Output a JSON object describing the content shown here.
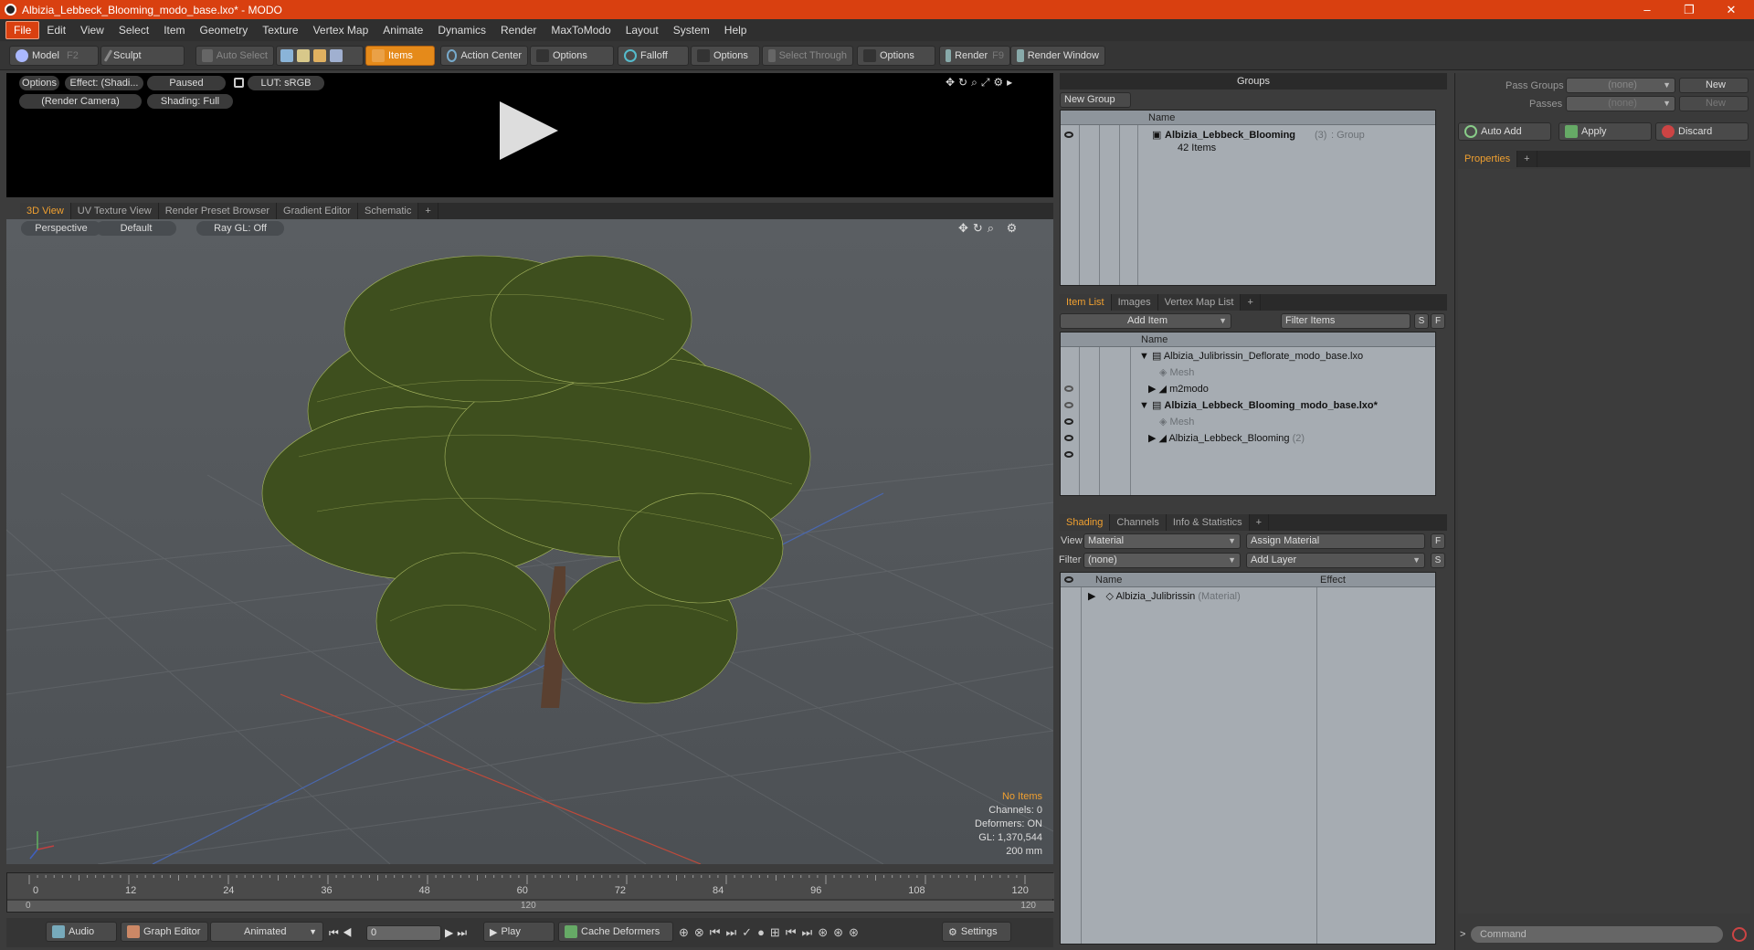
{
  "window": {
    "title": "Albizia_Lebbeck_Blooming_modo_base.lxo* - MODO",
    "minimize": "–",
    "restore": "❐",
    "close": "✕"
  },
  "menu": [
    "File",
    "Edit",
    "View",
    "Select",
    "Item",
    "Geometry",
    "Texture",
    "Vertex Map",
    "Animate",
    "Dynamics",
    "Render",
    "MaxToModo",
    "Layout",
    "System",
    "Help"
  ],
  "toolbar": {
    "model": "Model",
    "model_key": "F2",
    "sculpt": "Sculpt",
    "auto_select": "Auto Select",
    "items": "Items",
    "action_center": "Action Center",
    "options1": "Options",
    "falloff": "Falloff",
    "options2": "Options",
    "select_through": "Select Through",
    "options3": "Options",
    "render": "Render",
    "render_key": "F9",
    "render_window": "Render Window"
  },
  "render_preview": {
    "options": "Options",
    "effect": "Effect: (Shadi...",
    "paused": "Paused",
    "lut": "LUT: sRGB",
    "camera": "(Render Camera)",
    "shading": "Shading: Full"
  },
  "view_tabs": [
    "3D View",
    "UV Texture View",
    "Render Preset Browser",
    "Gradient Editor",
    "Schematic",
    "+"
  ],
  "viewport": {
    "projection": "Perspective",
    "style": "Default",
    "raygl": "Ray GL: Off",
    "stats": {
      "items": "No Items",
      "channels": "Channels: 0",
      "deformers": "Deformers: ON",
      "gl": "GL: 1,370,544",
      "scale": "200 mm"
    }
  },
  "timeline": {
    "ticks": [
      "0",
      "12",
      "24",
      "36",
      "48",
      "60",
      "72",
      "84",
      "96",
      "108",
      "120"
    ],
    "sub_start": "0",
    "sub_mid": "120",
    "sub_end": "120"
  },
  "bottom": {
    "audio": "Audio",
    "graph_editor": "Graph Editor",
    "animated": "Animated",
    "frame": "0",
    "play": "Play",
    "cache": "Cache Deformers",
    "settings": "Settings"
  },
  "groups": {
    "title": "Groups",
    "new_group": "New Group",
    "col_name": "Name",
    "group_name": "Albizia_Lebbeck_Blooming",
    "group_count": "(3)",
    "group_type": ": Group",
    "items_count": "42 Items"
  },
  "item_list": {
    "tabs": [
      "Item List",
      "Images",
      "Vertex Map List",
      "+"
    ],
    "add_item": "Add Item",
    "filter": "Filter Items",
    "s": "S",
    "f": "F",
    "col_name": "Name",
    "rows": [
      {
        "label": "Albizia_Julibrissin_Deflorate_modo_base.lxo",
        "bold": false,
        "indent": 0,
        "arrow": "▼"
      },
      {
        "label": "Mesh",
        "bold": false,
        "indent": 1,
        "arrow": "",
        "gray": true
      },
      {
        "label": "m2modo",
        "bold": false,
        "indent": 1,
        "arrow": "▶"
      },
      {
        "label": "Albizia_Lebbeck_Blooming_modo_base.lxo*",
        "bold": true,
        "indent": 0,
        "arrow": "▼"
      },
      {
        "label": "Mesh",
        "bold": false,
        "indent": 1,
        "arrow": "",
        "gray": true
      },
      {
        "label": "Albizia_Lebbeck_Blooming",
        "bold": false,
        "indent": 1,
        "arrow": "▶",
        "suffix": "(2)"
      }
    ]
  },
  "shading": {
    "tabs": [
      "Shading",
      "Channels",
      "Info & Statistics",
      "+"
    ],
    "view_label": "View",
    "view_value": "Material",
    "assign": "Assign Material",
    "filter_label": "Filter",
    "filter_value": "(none)",
    "add_layer": "Add Layer",
    "f": "F",
    "s": "S",
    "col_name": "Name",
    "col_effect": "Effect",
    "row": "Albizia_Julibrissin",
    "row_type": "(Material)"
  },
  "pass": {
    "pass_groups": "Pass Groups",
    "passes": "Passes",
    "none1": "(none)",
    "none2": "(none)",
    "new1": "New",
    "new2": "New",
    "auto_add": "Auto Add",
    "apply": "Apply",
    "discard": "Discard"
  },
  "properties": {
    "tab": "Properties",
    "plus": "+"
  },
  "command": {
    "placeholder": "Command",
    "prompt": ">"
  },
  "colors": {
    "accent": "#d94010",
    "tab_active": "#f0a030",
    "list_bg": "#a6acb2"
  }
}
